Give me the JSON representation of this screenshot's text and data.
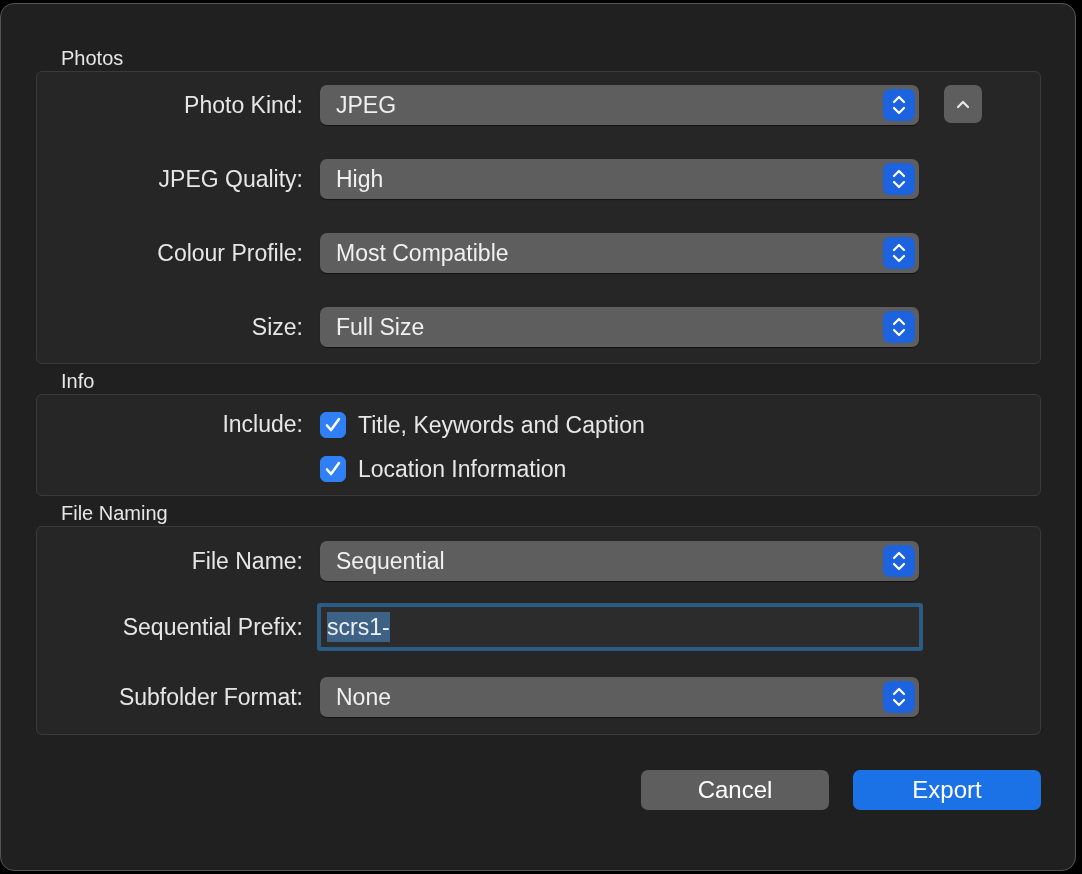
{
  "sections": [
    {
      "title": "Photos",
      "collapse_button": {
        "expanded": true
      },
      "rows": [
        {
          "kind": "popup",
          "label": "Photo Kind:",
          "value": "JPEG"
        },
        {
          "kind": "popup",
          "label": "JPEG Quality:",
          "value": "High"
        },
        {
          "kind": "popup",
          "label": "Colour Profile:",
          "value": "Most Compatible"
        },
        {
          "kind": "popup",
          "label": "Size:",
          "value": "Full Size"
        }
      ]
    },
    {
      "title": "Info",
      "rows": [
        {
          "kind": "checkboxes",
          "label": "Include:",
          "options": [
            {
              "label": "Title, Keywords and Caption",
              "checked": true
            },
            {
              "label": "Location Information",
              "checked": true
            }
          ]
        }
      ]
    },
    {
      "title": "File Naming",
      "rows": [
        {
          "kind": "popup",
          "label": "File Name:",
          "value": "Sequential"
        },
        {
          "kind": "textfield",
          "label": "Sequential Prefix:",
          "value": "scrs1-",
          "text_highlighted": true
        },
        {
          "kind": "popup",
          "label": "Subfolder Format:",
          "value": "None"
        }
      ]
    }
  ],
  "buttons": [
    {
      "label": "Cancel",
      "kind": "secondary"
    },
    {
      "label": "Export",
      "kind": "primary"
    }
  ]
}
